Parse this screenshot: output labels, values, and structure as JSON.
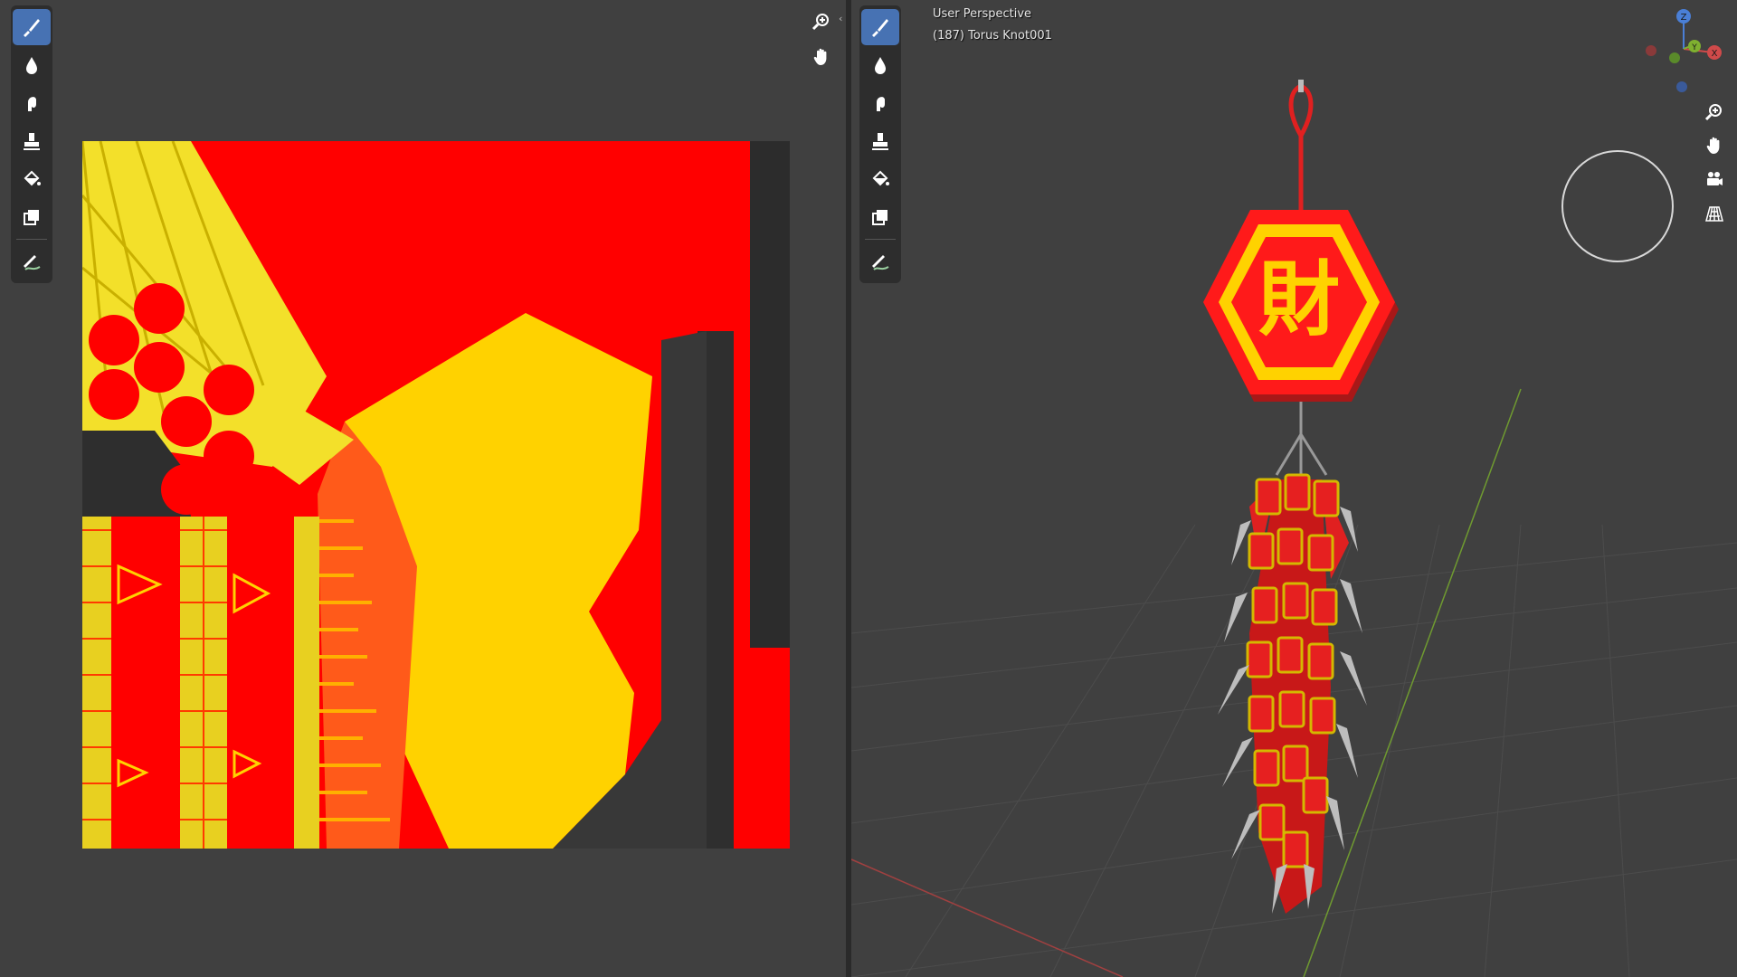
{
  "viewport": {
    "view_name": "User Perspective",
    "object_info": "(187) Torus Knot001",
    "sign_character": "財"
  },
  "gizmo": {
    "x": "X",
    "y": "Y",
    "z": "Z"
  },
  "image_editor": {
    "tools": [
      "draw-tool",
      "soften-tool",
      "smear-tool",
      "clone-tool",
      "fill-tool",
      "mask-tool",
      "annotate-tool"
    ],
    "nav": [
      "zoom-icon",
      "hand-pan-icon"
    ]
  },
  "viewport_tools": [
    "draw-tool",
    "soften-tool",
    "smear-tool",
    "clone-tool",
    "fill-tool",
    "mask-tool",
    "annotate-tool"
  ],
  "viewport_nav": [
    "zoom-icon",
    "hand-pan-icon",
    "camera-icon",
    "grid-icon"
  ],
  "colors": {
    "panel_bg": "#404040",
    "active_tool": "#4772b3",
    "texture_red": "#ff0000",
    "texture_yellow": "#ffd200"
  }
}
